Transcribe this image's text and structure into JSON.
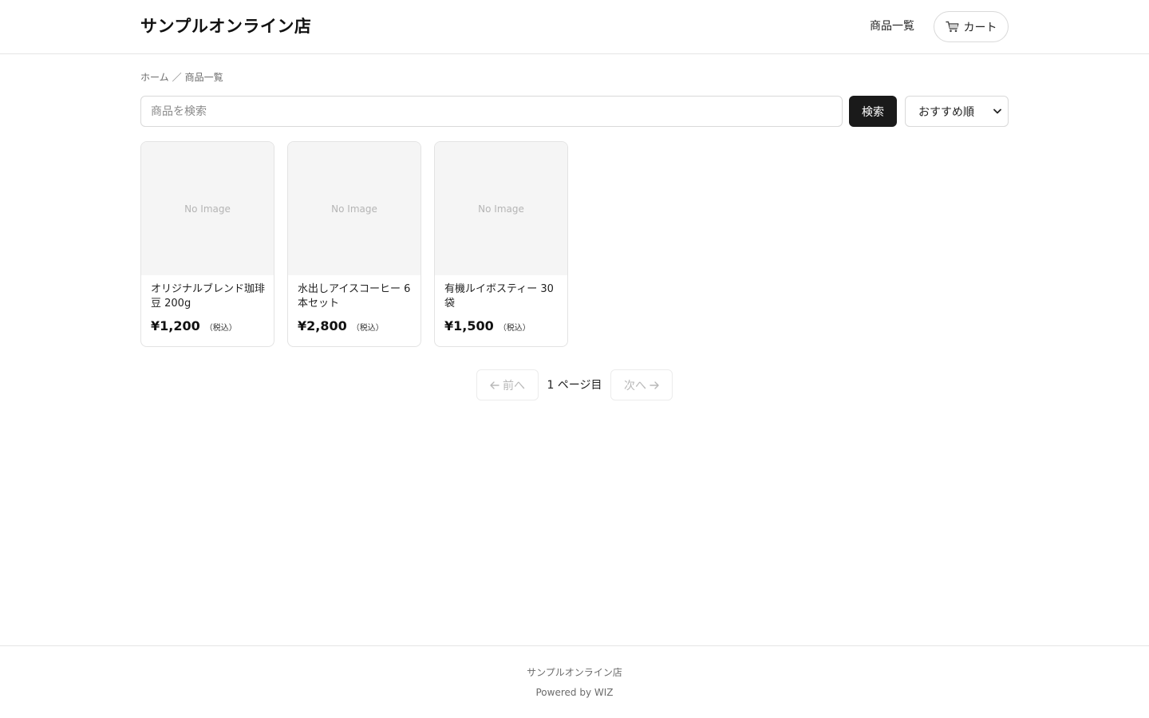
{
  "header": {
    "logo": "サンプルオンライン店",
    "nav_products": "商品一覧",
    "cart_label": "カート",
    "cart_icon": "shopping-cart-icon"
  },
  "breadcrumb": {
    "home": "ホーム",
    "separator": "／",
    "current": "商品一覧"
  },
  "search": {
    "placeholder": "商品を検索",
    "value": "",
    "button_label": "検索"
  },
  "sort": {
    "selected": "おすすめ順"
  },
  "products": [
    {
      "image_placeholder": "No Image",
      "name": "オリジナルブレンド珈琲豆 200g",
      "price": "¥1,200",
      "tax_note": "（税込）"
    },
    {
      "image_placeholder": "No Image",
      "name": "水出しアイスコーヒー 6本セット",
      "price": "¥2,800",
      "tax_note": "（税込）"
    },
    {
      "image_placeholder": "No Image",
      "name": "有機ルイボスティー 30袋",
      "price": "¥1,500",
      "tax_note": "（税込）"
    }
  ],
  "pagination": {
    "prev_label": "前へ",
    "current_label": "1 ページ目",
    "next_label": "次へ",
    "prev_disabled": true,
    "next_disabled": true
  },
  "footer": {
    "store_name": "サンプルオンライン店",
    "powered_by": "Powered by WIZ"
  },
  "colors": {
    "accent": "#1a1a1a",
    "border": "#e3e3e3",
    "muted_text": "#6b6b6b",
    "image_placeholder_bg": "#f5f5f5"
  }
}
